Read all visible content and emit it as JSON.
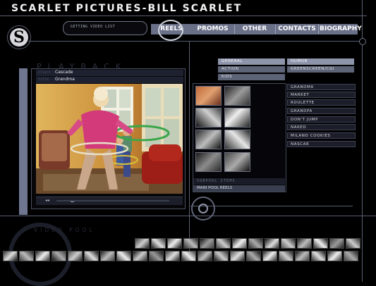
{
  "header": {
    "title": "SCARLET PICTURES-BILL SCARLET"
  },
  "status": {
    "text": "GETTING VIDEO LIST"
  },
  "nav": {
    "items": [
      "REELS",
      "PROMOS",
      "OTHER",
      "CONTACTS",
      "BIOGRAPHY"
    ],
    "active": "REELS"
  },
  "logo": {
    "letter": "S"
  },
  "playback": {
    "label": "PLAYBACK",
    "rows": [
      {
        "tag": "client",
        "value": "Cascade"
      },
      {
        "tag": "title",
        "value": "Grandma"
      }
    ]
  },
  "categories": {
    "left": [
      "GENERAL",
      "ACTION",
      "KIDS"
    ],
    "right": [
      "HUMOR",
      "GREENSCREEN/CGI"
    ],
    "highlighted": [
      "GENERAL",
      "HUMOR"
    ]
  },
  "subpool": {
    "label": "SUBPOOL ITEMS",
    "main_pool": "MAIN POOL REELS"
  },
  "reel_list": [
    "GRANDMA",
    "MARKET",
    "ROULETTE",
    "GRANDPA",
    "DON'T JUMP",
    "NAKED",
    "MILANO COOKIES",
    "NASCAR"
  ],
  "video_pool": {
    "label": "VIDEO POOL"
  },
  "colors": {
    "nav_bar": "#6a7088",
    "category_lit": "#8e95ab",
    "background": "#000000",
    "accent_line": "#5a5f72"
  }
}
